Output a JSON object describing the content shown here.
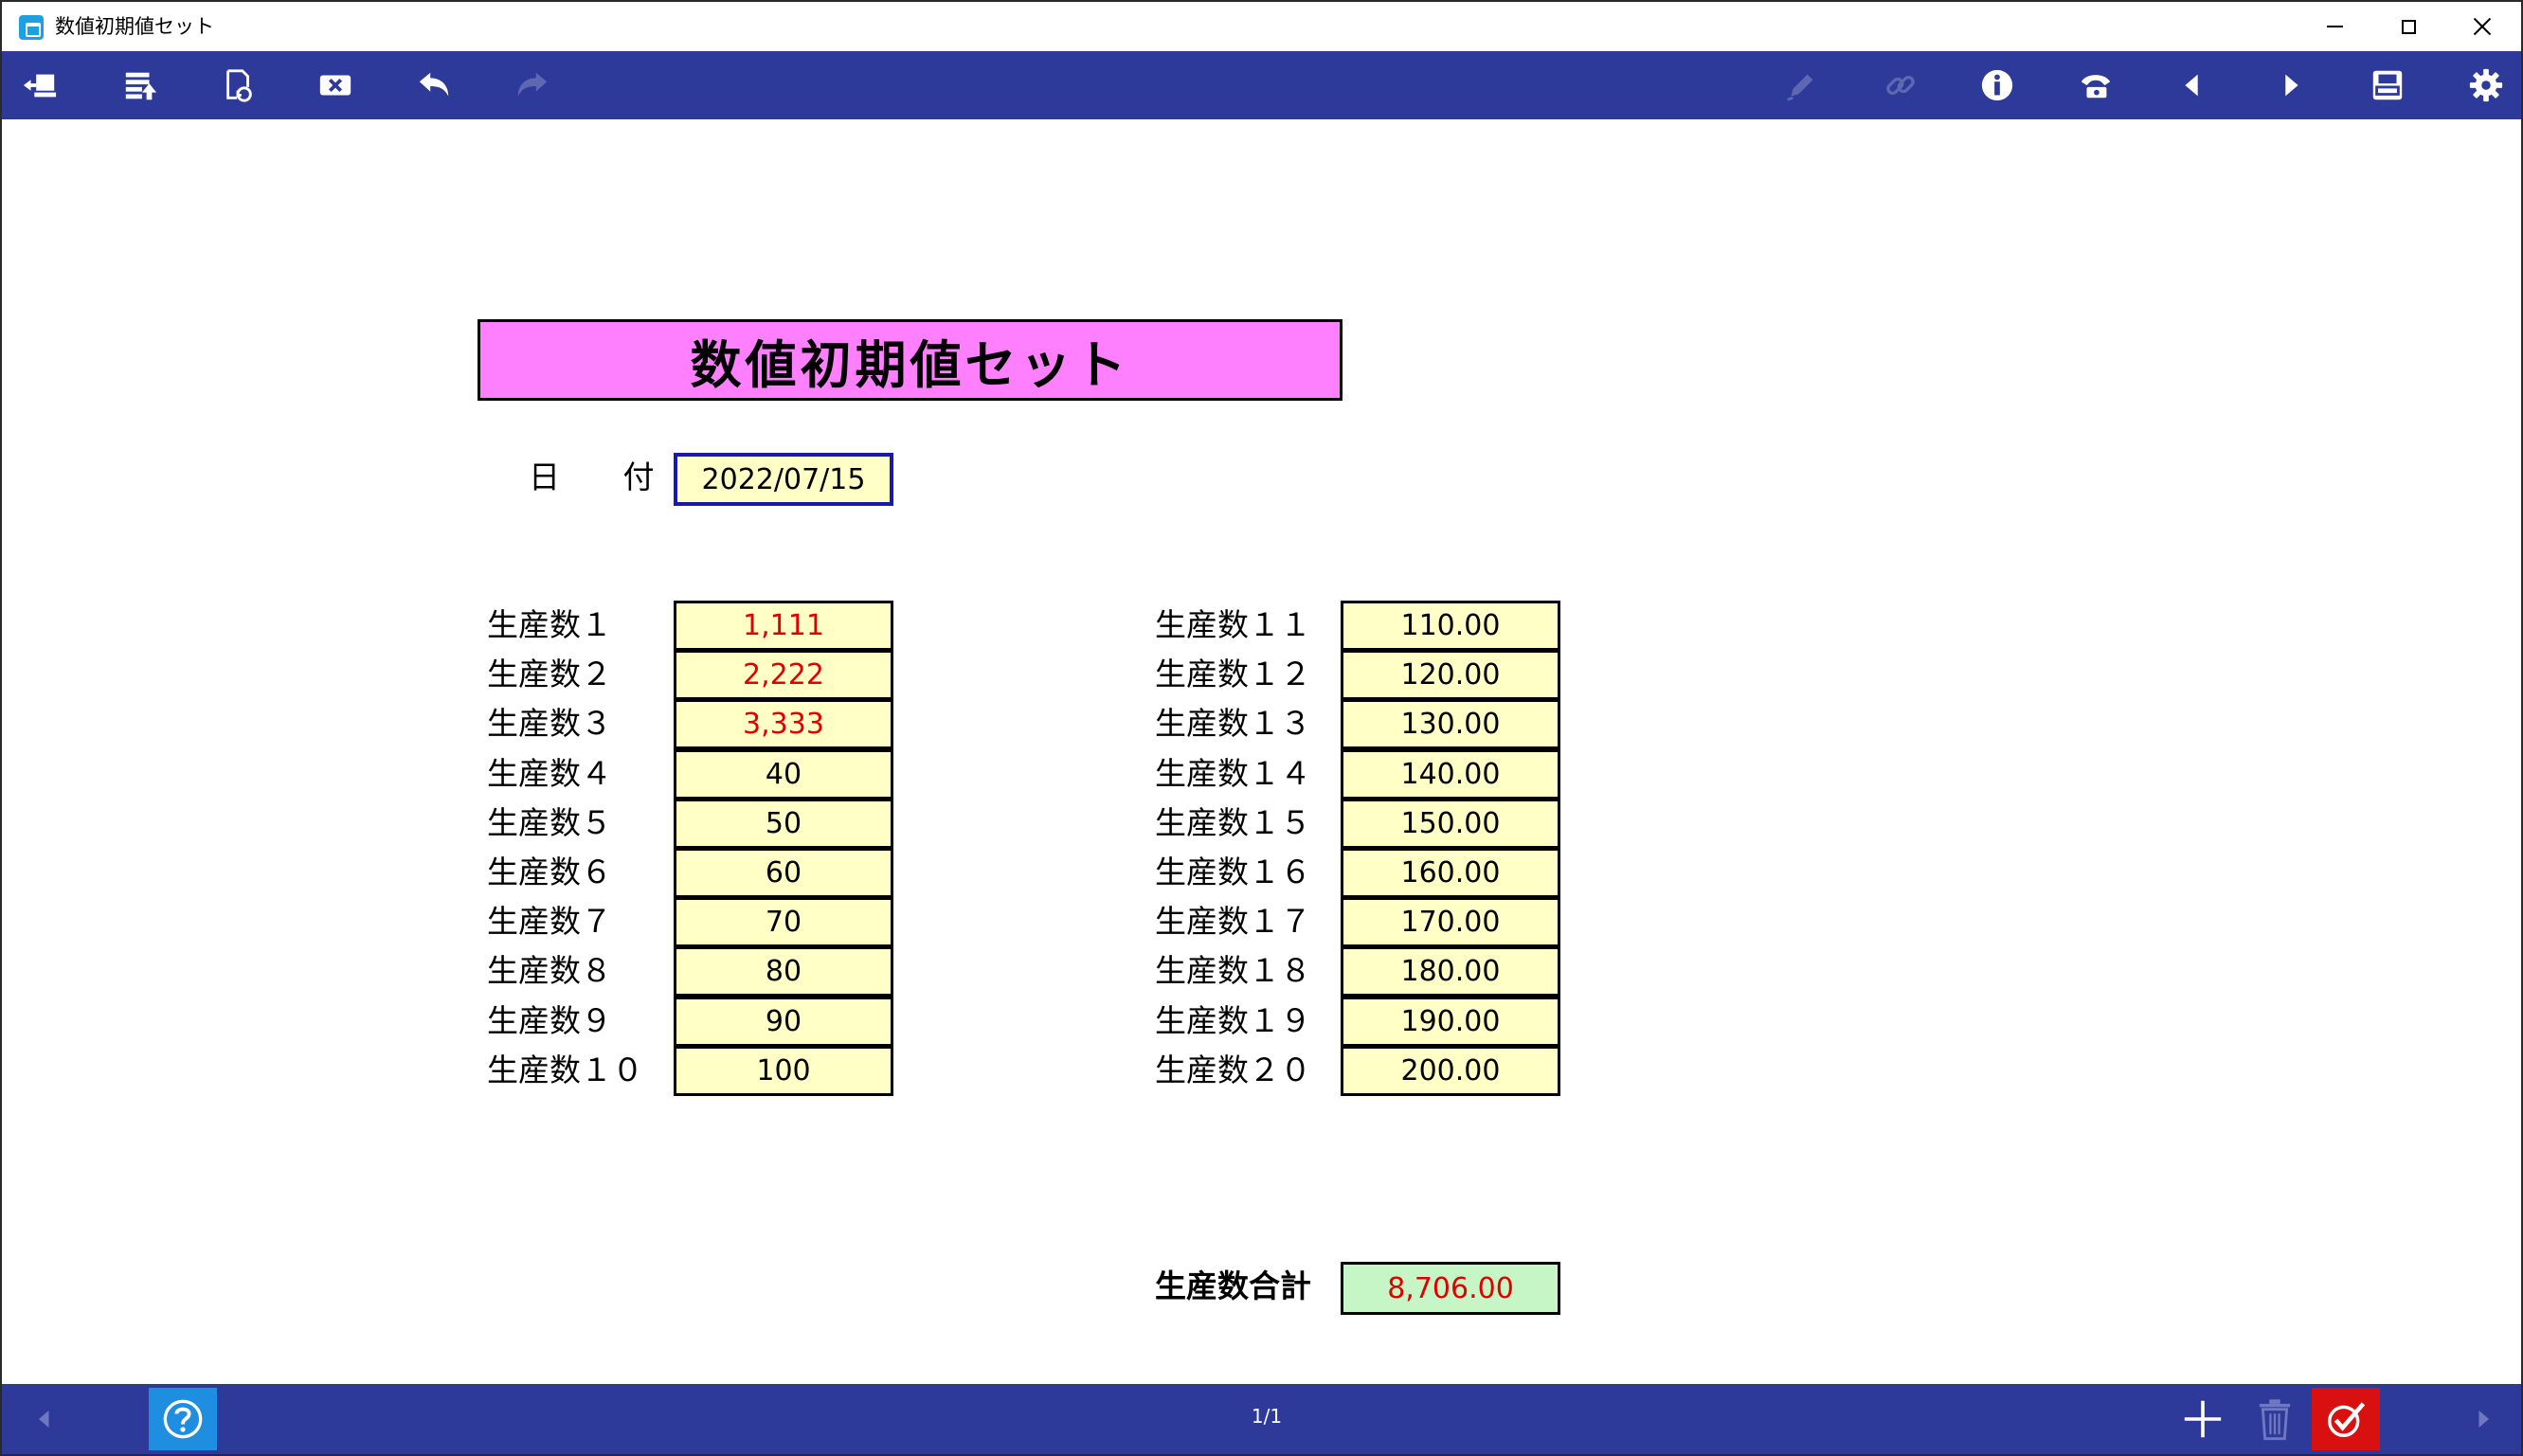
{
  "window": {
    "title": "数値初期値セット"
  },
  "toolbar": {
    "left_icons": [
      "back-to-list-icon",
      "upload-icon",
      "copy-icon",
      "clear-icon",
      "undo-icon",
      "redo-icon"
    ],
    "right_icons": [
      "pen-icon",
      "link-icon",
      "info-icon",
      "phone-icon",
      "prev-icon",
      "next-icon",
      "print-icon",
      "gear-icon"
    ]
  },
  "form": {
    "title": "数値初期値セット",
    "date_label": "日 付",
    "date_value": "2022/07/15",
    "left_items": [
      {
        "label": "生産数１",
        "value": "1,111"
      },
      {
        "label": "生産数２",
        "value": "2,222"
      },
      {
        "label": "生産数３",
        "value": "3,333"
      },
      {
        "label": "生産数４",
        "value": "40"
      },
      {
        "label": "生産数５",
        "value": "50"
      },
      {
        "label": "生産数６",
        "value": "60"
      },
      {
        "label": "生産数７",
        "value": "70"
      },
      {
        "label": "生産数８",
        "value": "80"
      },
      {
        "label": "生産数９",
        "value": "90"
      },
      {
        "label": "生産数１０",
        "value": "100"
      }
    ],
    "right_items": [
      {
        "label": "生産数１１",
        "value": "110.00"
      },
      {
        "label": "生産数１２",
        "value": "120.00"
      },
      {
        "label": "生産数１３",
        "value": "130.00"
      },
      {
        "label": "生産数１４",
        "value": "140.00"
      },
      {
        "label": "生産数１５",
        "value": "150.00"
      },
      {
        "label": "生産数１６",
        "value": "160.00"
      },
      {
        "label": "生産数１７",
        "value": "170.00"
      },
      {
        "label": "生産数１８",
        "value": "180.00"
      },
      {
        "label": "生産数１９",
        "value": "190.00"
      },
      {
        "label": "生産数２０",
        "value": "200.00"
      }
    ],
    "total_label": "生産数合計",
    "total_value": "8,706.00",
    "colors": {
      "title_bg": "#ff80ff",
      "field_bg": "#ffffc6",
      "total_bg": "#c6f5c6",
      "highlight_text": "#e00000",
      "toolbar_bg": "#2e3a9a"
    }
  },
  "bottombar": {
    "page_indicator": "1/1"
  }
}
